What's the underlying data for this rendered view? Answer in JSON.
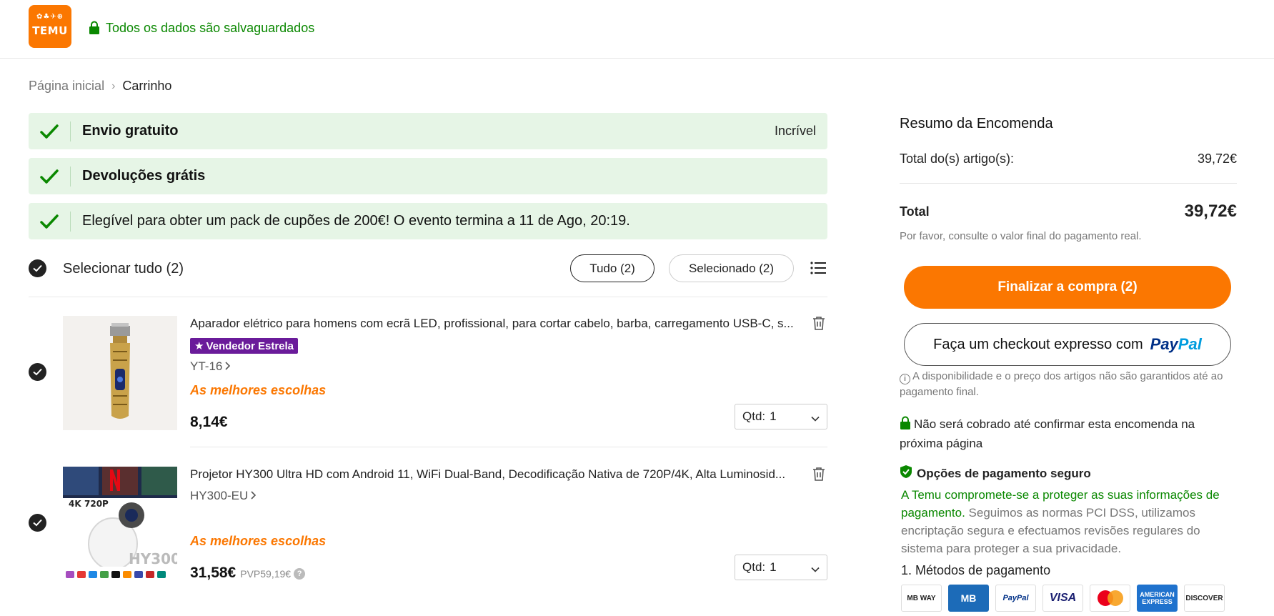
{
  "header": {
    "logo_glyphs": "✿♣✈⊕",
    "logo_text": "TEMU",
    "secure_message": "Todos os dados são salvaguardados"
  },
  "breadcrumb": {
    "home": "Página inicial",
    "separator": "›",
    "current": "Carrinho"
  },
  "benefits": [
    {
      "text": "Envio gratuito",
      "right": "Incrível"
    },
    {
      "text": "Devoluções grátis"
    },
    {
      "text": "Elegível para obter um pack de cupões de 200€! O evento termina a 11 de Ago, 20:19."
    }
  ],
  "select": {
    "all_label": "Selecionar tudo (2)",
    "tab_all": "Tudo (2)",
    "tab_selected": "Selecionado (2)"
  },
  "items": [
    {
      "title": "Aparador elétrico para homens com ecrã LED, profissional, para cortar cabelo, barba, carregamento USB-C, s...",
      "badge": "Vendedor Estrela",
      "variant": "YT-16",
      "tag": "As melhores escolhas",
      "price": "8,14€",
      "qty_label": "Qtd:",
      "qty": "1"
    },
    {
      "title": "Projetor HY300 Ultra HD com Android 11, WiFi Dual-Band, Decodificação Nativa de 720P/4K, Alta Luminosid...",
      "variant": "HY300-EU",
      "tag": "As melhores escolhas",
      "price": "31,58€",
      "rrp": "PVP59,19€",
      "qty_label": "Qtd:",
      "qty": "1",
      "thumb_text": {
        "t4k": "4K",
        "t720": "720P",
        "model": "HY300"
      }
    }
  ],
  "summary": {
    "title": "Resumo da Encomenda",
    "items_total_label": "Total do(s) artigo(s):",
    "items_total_value": "39,72€",
    "total_label": "Total",
    "total_value": "39,72€",
    "note": "Por favor, consulte o valor final do pagamento real.",
    "checkout_label": "Finalizar a compra (2)",
    "express_label": "Faça um checkout expresso com",
    "paypal_p1": "Pay",
    "paypal_p2": "Pal",
    "availability_note": "A disponibilidade e o preço dos artigos não são garantidos até ao pagamento final.",
    "charge_note": "Não será cobrado até confirmar esta encomenda na próxima página",
    "secure_title": "Opções de pagamento seguro",
    "secure_desc_green": "A Temu compromete-se a proteger as suas informações de pagamento.",
    "secure_desc_rest": " Seguimos as normas PCI DSS, utilizamos encriptação segura e efectuamos revisões regulares do sistema para proteger a sua privacidade.",
    "methods_title": "1. Métodos de pagamento",
    "methods": {
      "mbway": "MB WAY",
      "mb": "MB",
      "paypal": "PayPal",
      "visa": "VISA",
      "amex": "AMERICAN EXPRESS",
      "discover": "DISCOVER"
    }
  },
  "colors": {
    "brand_orange": "#fb7701",
    "secure_green": "#0a8800",
    "banner_bg": "#e6f5e6",
    "badge_purple": "#6a1b9a"
  }
}
